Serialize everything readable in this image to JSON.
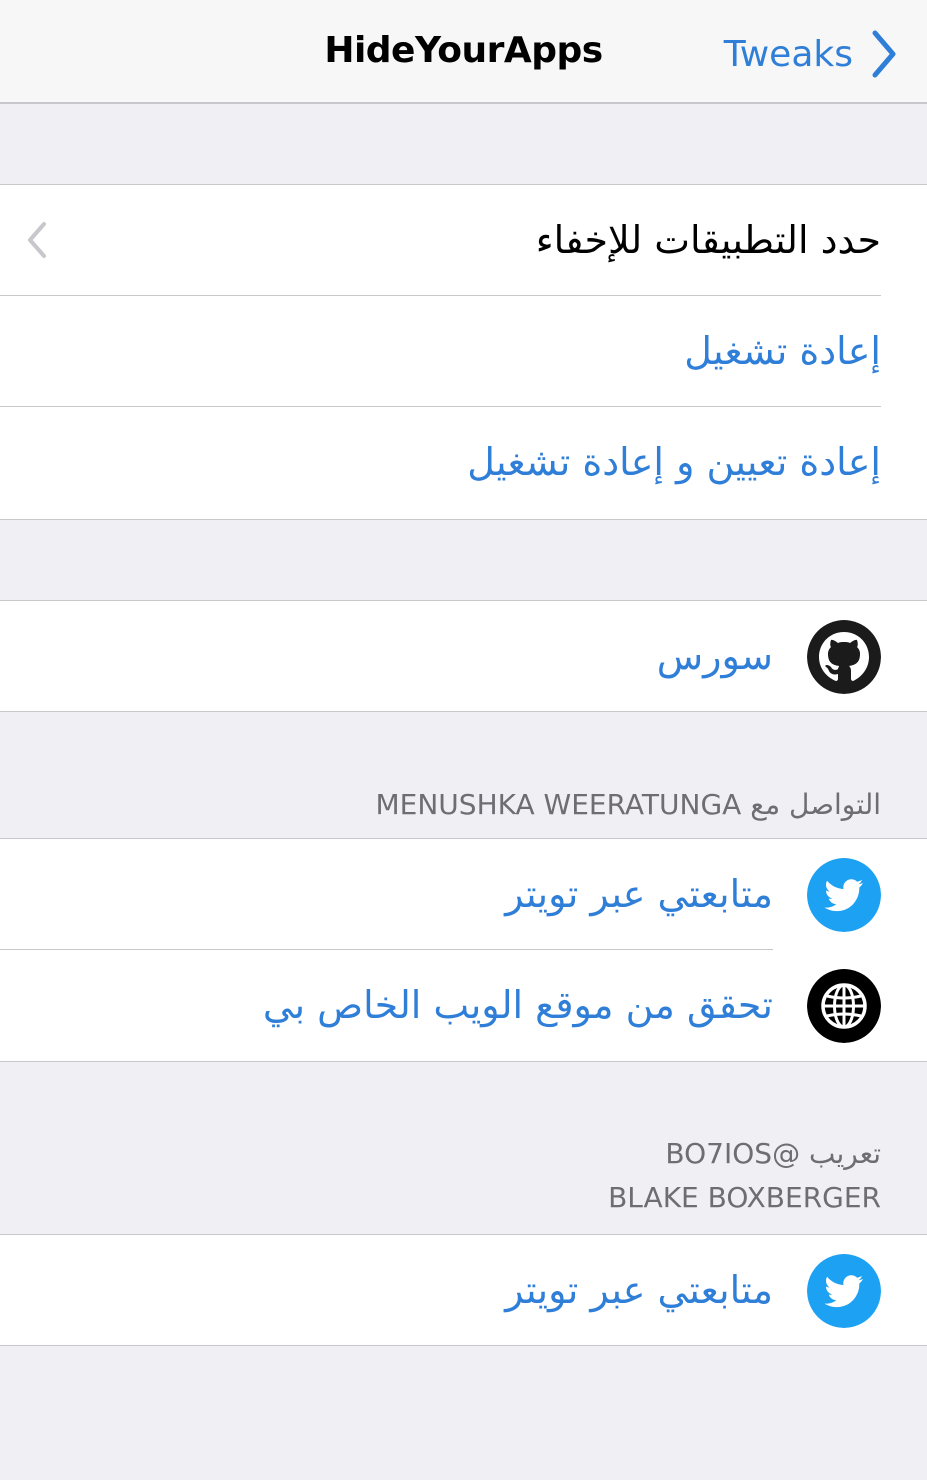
{
  "navbar": {
    "title": "HideYourApps",
    "back_label": "Tweaks"
  },
  "section1": {
    "items": [
      {
        "label": "حدد التطبيقات للإخفاء"
      },
      {
        "label": "إعادة تشغيل"
      },
      {
        "label": "إعادة تعيين و إعادة تشغيل"
      }
    ]
  },
  "section2": {
    "items": [
      {
        "label": "سورس",
        "icon": "github-icon"
      }
    ]
  },
  "section3": {
    "header": "التواصل مع MENUSHKA WEERATUNGA",
    "items": [
      {
        "label": "متابعتي عبر تويتر",
        "icon": "twitter-icon"
      },
      {
        "label": "تحقق من موقع الويب الخاص بي",
        "icon": "globe-icon"
      }
    ]
  },
  "section4": {
    "header_line1": "تعريب @BO7IOS",
    "header_line2": "BLAKE BOXBERGER",
    "items": [
      {
        "label": "متابعتي عبر تويتر",
        "icon": "twitter-icon"
      }
    ]
  },
  "colors": {
    "background": "#efeff4",
    "accent": "#2f7ed8",
    "twitter": "#1da1f2",
    "separator": "#c8c7cc"
  }
}
